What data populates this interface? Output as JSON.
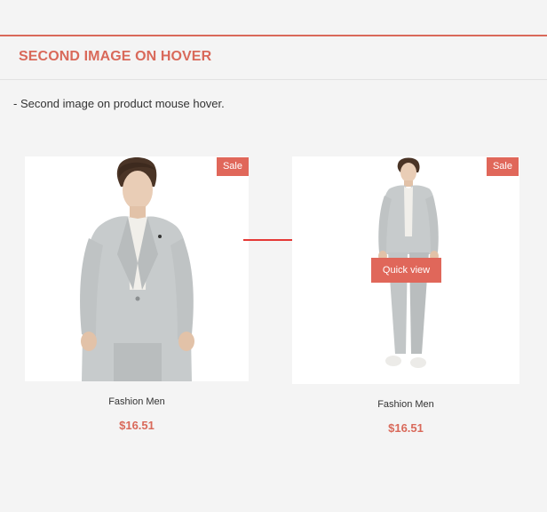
{
  "section": {
    "title": "Second image on hover",
    "description": "- Second image on product mouse hover."
  },
  "products": [
    {
      "name": "Fashion Men",
      "price": "$16.51",
      "badge": "Sale",
      "image_desc": "man-in-grey-suit-closeup"
    },
    {
      "name": "Fashion Men",
      "price": "$16.51",
      "badge": "Sale",
      "quick_view_label": "Quick view",
      "image_desc": "man-in-grey-suit-full-body"
    }
  ],
  "colors": {
    "accent": "#d9695a",
    "badge": "#e0675a",
    "arrow": "#e53935",
    "background": "#f4f4f4"
  }
}
